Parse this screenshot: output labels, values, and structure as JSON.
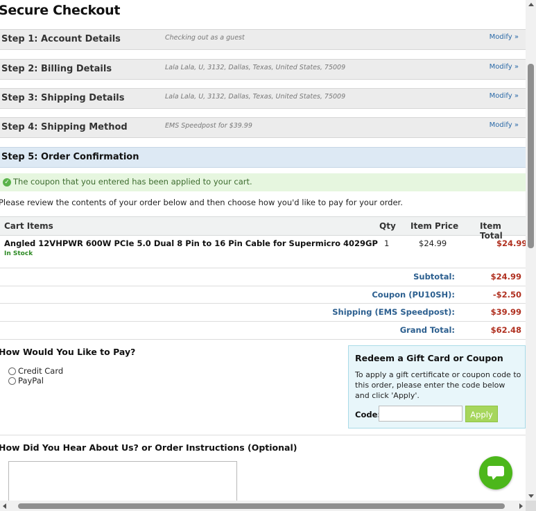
{
  "page": {
    "title": "Secure Checkout"
  },
  "steps": [
    {
      "label": "Step 1: Account Details",
      "info": "Checking out as a guest",
      "modify": "Modify »"
    },
    {
      "label": "Step 2: Billing Details",
      "info": "Lala Lala, U, 3132, Dallas, Texas, United States, 75009",
      "modify": "Modify »"
    },
    {
      "label": "Step 3: Shipping Details",
      "info": "Lala Lala, U, 3132, Dallas, Texas, United States, 75009",
      "modify": "Modify »"
    },
    {
      "label": "Step 4: Shipping Method",
      "info": "EMS Speedpost for $39.99",
      "modify": "Modify »"
    }
  ],
  "step5": {
    "label": "Step 5: Order Confirmation"
  },
  "notice": {
    "message": "The coupon that you entered has been applied to your cart.",
    "icon": "check-circle-icon"
  },
  "intro": "Please review the contents of your order below and then choose how you'd like to pay for your order.",
  "cart": {
    "headers": {
      "items": "Cart Items",
      "qty": "Qty",
      "price": "Item Price",
      "total": "Item Total"
    },
    "items": [
      {
        "name": "Angled 12VHPWR 600W PCIe 5.0 Dual 8 Pin to 16 Pin Cable for Supermicro 4029GP",
        "stock": "In Stock",
        "qty": "1",
        "price": "$24.99",
        "total": "$24.99"
      }
    ]
  },
  "summary": [
    {
      "label": "Subtotal:",
      "value": "$24.99"
    },
    {
      "label": "Coupon (PU10SH):",
      "value": "-$2.50"
    },
    {
      "label": "Shipping (EMS Speedpost):",
      "value": "$39.99"
    },
    {
      "label": "Grand Total:",
      "value": "$62.48"
    }
  ],
  "payment": {
    "title": "How Would You Like to Pay?",
    "options": [
      "Credit Card",
      "PayPal"
    ]
  },
  "gift": {
    "title": "Redeem a Gift Card or Coupon",
    "description": "To apply a gift certificate or coupon code to this order, please enter the code below and click 'Apply'.",
    "code_label": "Code:",
    "code_value": "",
    "apply_label": "Apply"
  },
  "instructions": {
    "title": "How Did You Hear About Us? or Order Instructions (Optional)"
  },
  "colors": {
    "accent_link": "#2b6aa8",
    "price_red": "#b03020",
    "apply_green": "#a6d65c",
    "chat_green": "#4cb71b"
  },
  "chat": {
    "icon": "chat-bubble-icon"
  }
}
